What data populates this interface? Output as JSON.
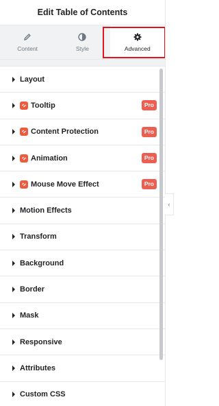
{
  "header": {
    "title": "Edit Table of Contents"
  },
  "tabs": [
    {
      "label": "Content",
      "icon": "pencil-icon"
    },
    {
      "label": "Style",
      "icon": "half-circle-icon"
    },
    {
      "label": "Advanced",
      "icon": "gear-icon"
    }
  ],
  "colors": {
    "pro_badge": "#ec5f50",
    "highlight_border": "#e2121b",
    "addon_icon": "#f05a3c"
  },
  "sections": [
    {
      "label": "Layout"
    },
    {
      "label": "Tooltip",
      "badge": "Pro"
    },
    {
      "label": "Content Protection",
      "badge": "Pro"
    },
    {
      "label": "Animation",
      "badge": "Pro"
    },
    {
      "label": "Mouse Move Effect",
      "badge": "Pro"
    },
    {
      "label": "Motion Effects"
    },
    {
      "label": "Transform"
    },
    {
      "label": "Background"
    },
    {
      "label": "Border"
    },
    {
      "label": "Mask"
    },
    {
      "label": "Responsive"
    },
    {
      "label": "Attributes"
    },
    {
      "label": "Custom CSS"
    }
  ]
}
